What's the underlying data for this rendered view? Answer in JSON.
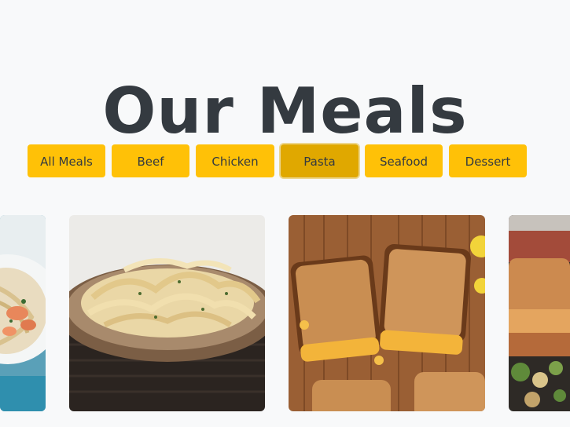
{
  "page": {
    "title": "Our Meals"
  },
  "filters": [
    {
      "label": "All Meals",
      "active": false
    },
    {
      "label": "Beef",
      "active": false
    },
    {
      "label": "Chicken",
      "active": false
    },
    {
      "label": "Pasta",
      "active": true
    },
    {
      "label": "Seafood",
      "active": false
    },
    {
      "label": "Dessert",
      "active": false
    }
  ],
  "colors": {
    "accent": "#ffc107",
    "accent_active": "#e0a800",
    "title": "#343a40",
    "background": "#f8f9fa"
  },
  "meals": [
    {
      "image": "shrimp-pasta-photo"
    },
    {
      "image": "fettuccine-alfredo-photo"
    },
    {
      "image": "grilled-cheese-mac-photo"
    },
    {
      "image": "grilled-cheese-salad-photo"
    }
  ]
}
